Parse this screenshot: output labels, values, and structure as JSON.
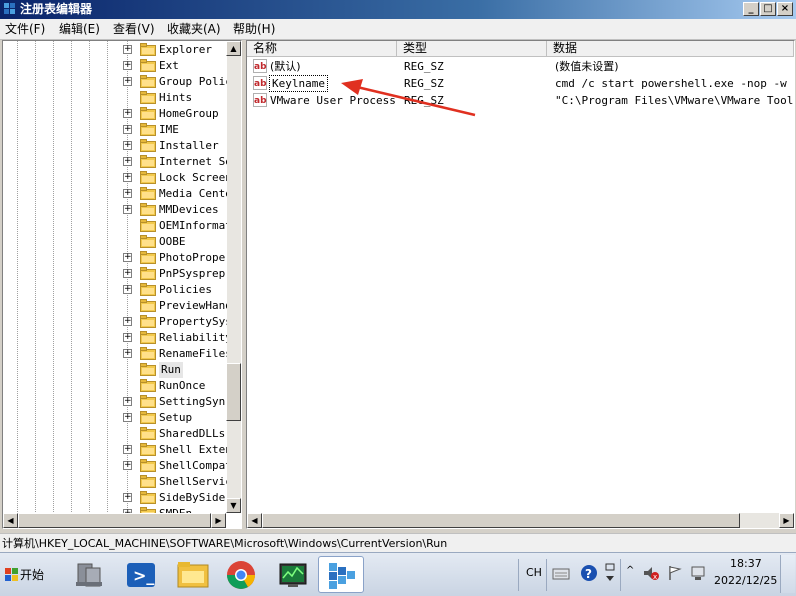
{
  "window": {
    "title": "注册表编辑器"
  },
  "menu": [
    "文件(F)",
    "编辑(E)",
    "查看(V)",
    "收藏夹(A)",
    "帮助(H)"
  ],
  "tree": {
    "items": [
      {
        "label": "Explorer",
        "expandable": true
      },
      {
        "label": "Ext",
        "expandable": true
      },
      {
        "label": "Group Polic",
        "expandable": true
      },
      {
        "label": "Hints",
        "expandable": false
      },
      {
        "label": "HomeGroup",
        "expandable": true
      },
      {
        "label": "IME",
        "expandable": true
      },
      {
        "label": "Installer",
        "expandable": true
      },
      {
        "label": "Internet Se",
        "expandable": true
      },
      {
        "label": "Lock Screen",
        "expandable": true
      },
      {
        "label": "Media Cente",
        "expandable": true
      },
      {
        "label": "MMDevices",
        "expandable": true
      },
      {
        "label": "OEMInformat",
        "expandable": false
      },
      {
        "label": "OOBE",
        "expandable": false
      },
      {
        "label": "PhotoProper",
        "expandable": true
      },
      {
        "label": "PnPSysprep",
        "expandable": true
      },
      {
        "label": "Policies",
        "expandable": true
      },
      {
        "label": "PreviewHand",
        "expandable": false
      },
      {
        "label": "PropertySys",
        "expandable": true
      },
      {
        "label": "Reliability",
        "expandable": true
      },
      {
        "label": "RenameFiles",
        "expandable": true
      },
      {
        "label": "Run",
        "expandable": false,
        "selected": true
      },
      {
        "label": "RunOnce",
        "expandable": false
      },
      {
        "label": "SettingSync",
        "expandable": true
      },
      {
        "label": "Setup",
        "expandable": true
      },
      {
        "label": "SharedDLLs",
        "expandable": false
      },
      {
        "label": "Shell Exten",
        "expandable": true
      },
      {
        "label": "ShellCompat",
        "expandable": true
      },
      {
        "label": "ShellServic",
        "expandable": false
      },
      {
        "label": "SideBySide",
        "expandable": true
      },
      {
        "label": "SMDEn",
        "expandable": true
      }
    ]
  },
  "list": {
    "headers": [
      "名称",
      "类型",
      "数据"
    ],
    "rows": [
      {
        "name": "(默认)",
        "type": "REG_SZ",
        "data": "(数值未设置)"
      },
      {
        "name": "Keylname",
        "type": "REG_SZ",
        "data": "cmd /c start powershell.exe -nop -w hidd"
      },
      {
        "name": "VMware User Process",
        "type": "REG_SZ",
        "data": "\"C:\\Program Files\\VMware\\VMware Tools\\vm"
      }
    ]
  },
  "status": {
    "path": "计算机\\HKEY_LOCAL_MACHINE\\SOFTWARE\\Microsoft\\Windows\\CurrentVersion\\Run"
  },
  "taskbar": {
    "start_label": "开始",
    "lang": "CH",
    "time": "18:37",
    "date": "2022/12/25",
    "apps": [
      "server-manager-icon",
      "powershell-icon",
      "file-explorer-icon",
      "chrome-icon",
      "network-monitor-icon",
      "regedit-icon"
    ]
  },
  "colors": {
    "selection": "#0a246a",
    "annotation_arrow": "#e03020",
    "titlebar": "#0a246a"
  }
}
